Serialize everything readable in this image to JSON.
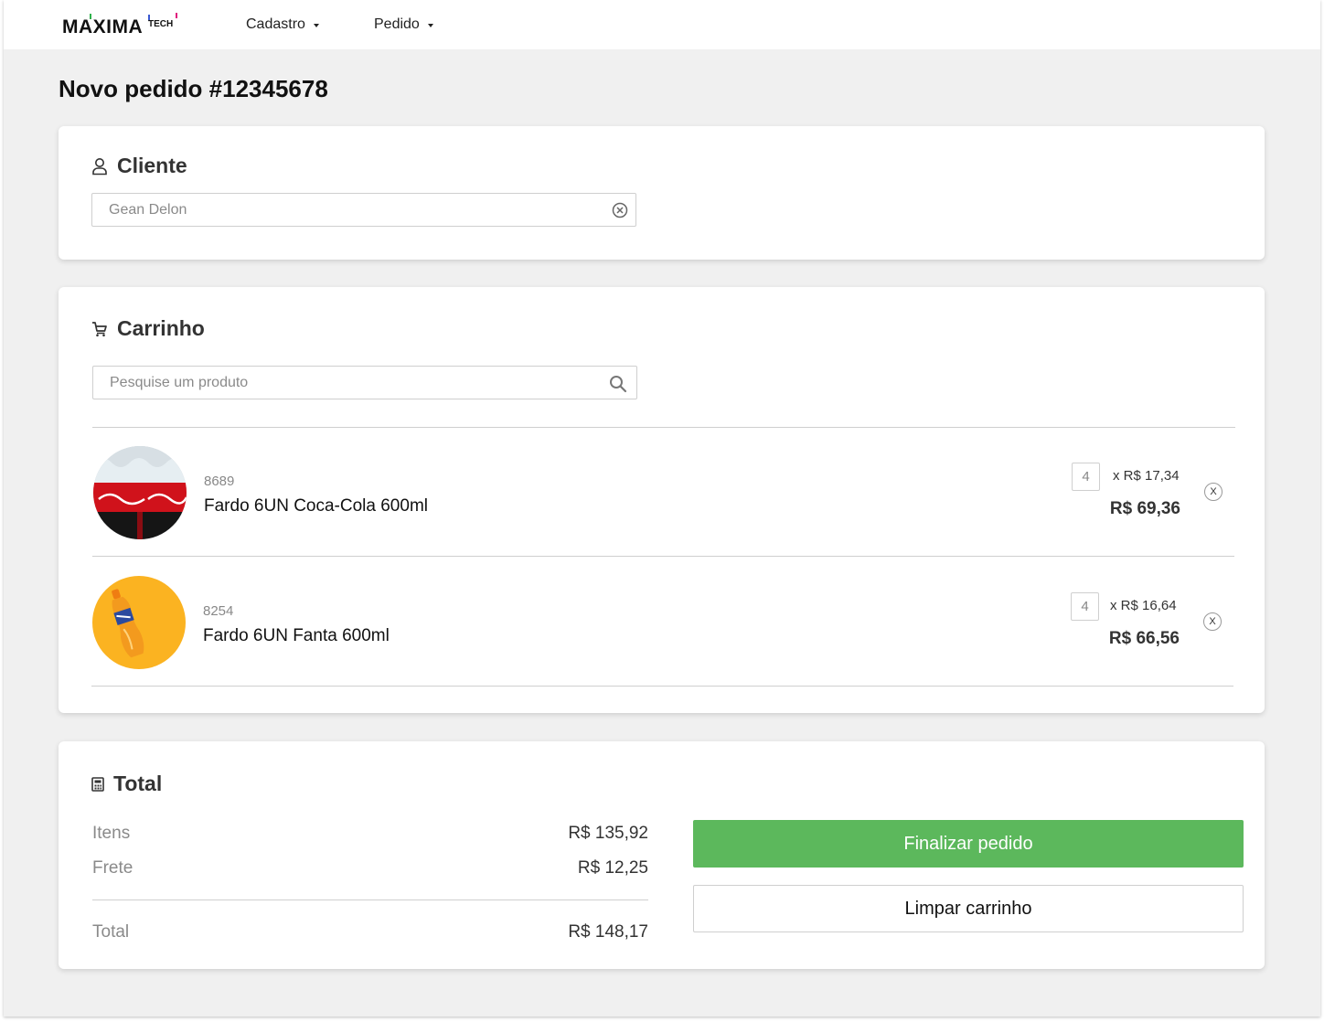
{
  "header": {
    "logo_main": "MAXIMA",
    "logo_sub": "TECH",
    "nav": [
      {
        "label": "Cadastro"
      },
      {
        "label": "Pedido"
      }
    ]
  },
  "page": {
    "title": "Novo pedido #12345678"
  },
  "cliente": {
    "title": "Cliente",
    "value": "Gean Delon"
  },
  "carrinho": {
    "title": "Carrinho",
    "search_placeholder": "Pesquise um produto",
    "items": [
      {
        "sku": "8689",
        "name": "Fardo 6UN Coca-Cola 600ml",
        "qty": "4",
        "unit_price": "x R$  17,34",
        "total": "R$  69,36",
        "remove": "X"
      },
      {
        "sku": "8254",
        "name": "Fardo 6UN Fanta 600ml",
        "qty": "4",
        "unit_price": "x R$  16,64",
        "total": "R$  66,56",
        "remove": "X"
      }
    ]
  },
  "totais": {
    "title": "Total",
    "itens_label": "Itens",
    "itens_value": "R$ 135,92",
    "frete_label": "Frete",
    "frete_value": "R$ 12,25",
    "total_label": "Total",
    "total_value": "R$  148,17",
    "finalizar": "Finalizar pedido",
    "limpar": "Limpar carrinho"
  },
  "colors": {
    "accent_green": "#5cb85c",
    "background": "#f0f0f0",
    "fanta_orange": "#fbb321",
    "coca_red": "#d0121b"
  }
}
